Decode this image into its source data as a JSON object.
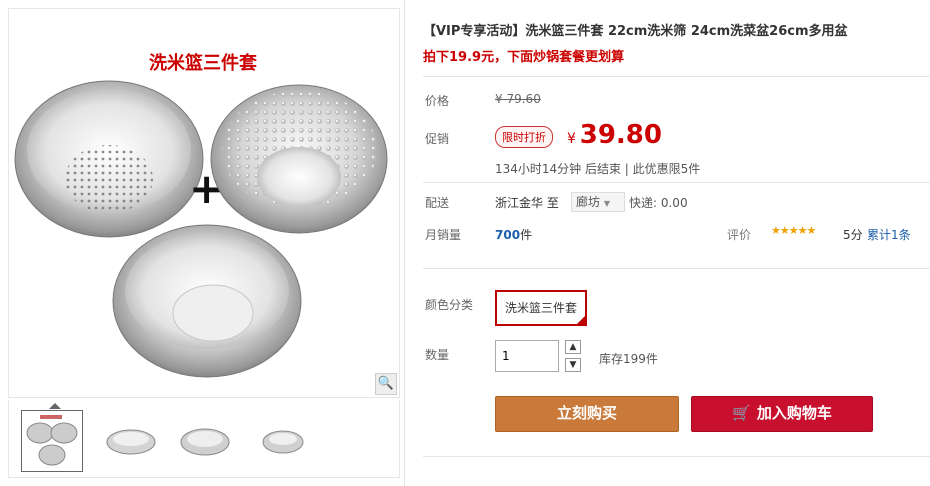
{
  "product": {
    "title": "【VIP专享活动】洗米篮三件套 22cm洗米筛 24cm洗菜盆26cm多用盆",
    "subtitle": "拍下19.9元，下面炒锅套餐更划算",
    "image_caption": "洗米篮三件套"
  },
  "price": {
    "label": "价格",
    "currency": "¥",
    "original": "79.60",
    "promo_label": "促销",
    "promo_badge": "限时打折",
    "current": "39.80",
    "countdown": "134小时14分钟 后结束 | 此优惠限5件"
  },
  "shipping": {
    "label": "配送",
    "from": "浙江金华  至",
    "to": "廊坊",
    "fee": "快递: 0.00"
  },
  "sales": {
    "label": "月销量",
    "count": "700",
    "unit": "件",
    "rating_label": "评价",
    "stars": "★★★★★",
    "score": "5分",
    "reviews": "累计1条"
  },
  "options": {
    "color_label": "颜色分类",
    "color_selected": "洗米篮三件套",
    "qty_label": "数量",
    "qty_value": "1",
    "stock": "库存199件"
  },
  "actions": {
    "buy": "立刻购买",
    "cart": "加入购物车"
  },
  "colors": {
    "accent": "#c00000",
    "buy": "#c97a3a",
    "cart": "#c8102e",
    "link": "#1a5eaa"
  }
}
